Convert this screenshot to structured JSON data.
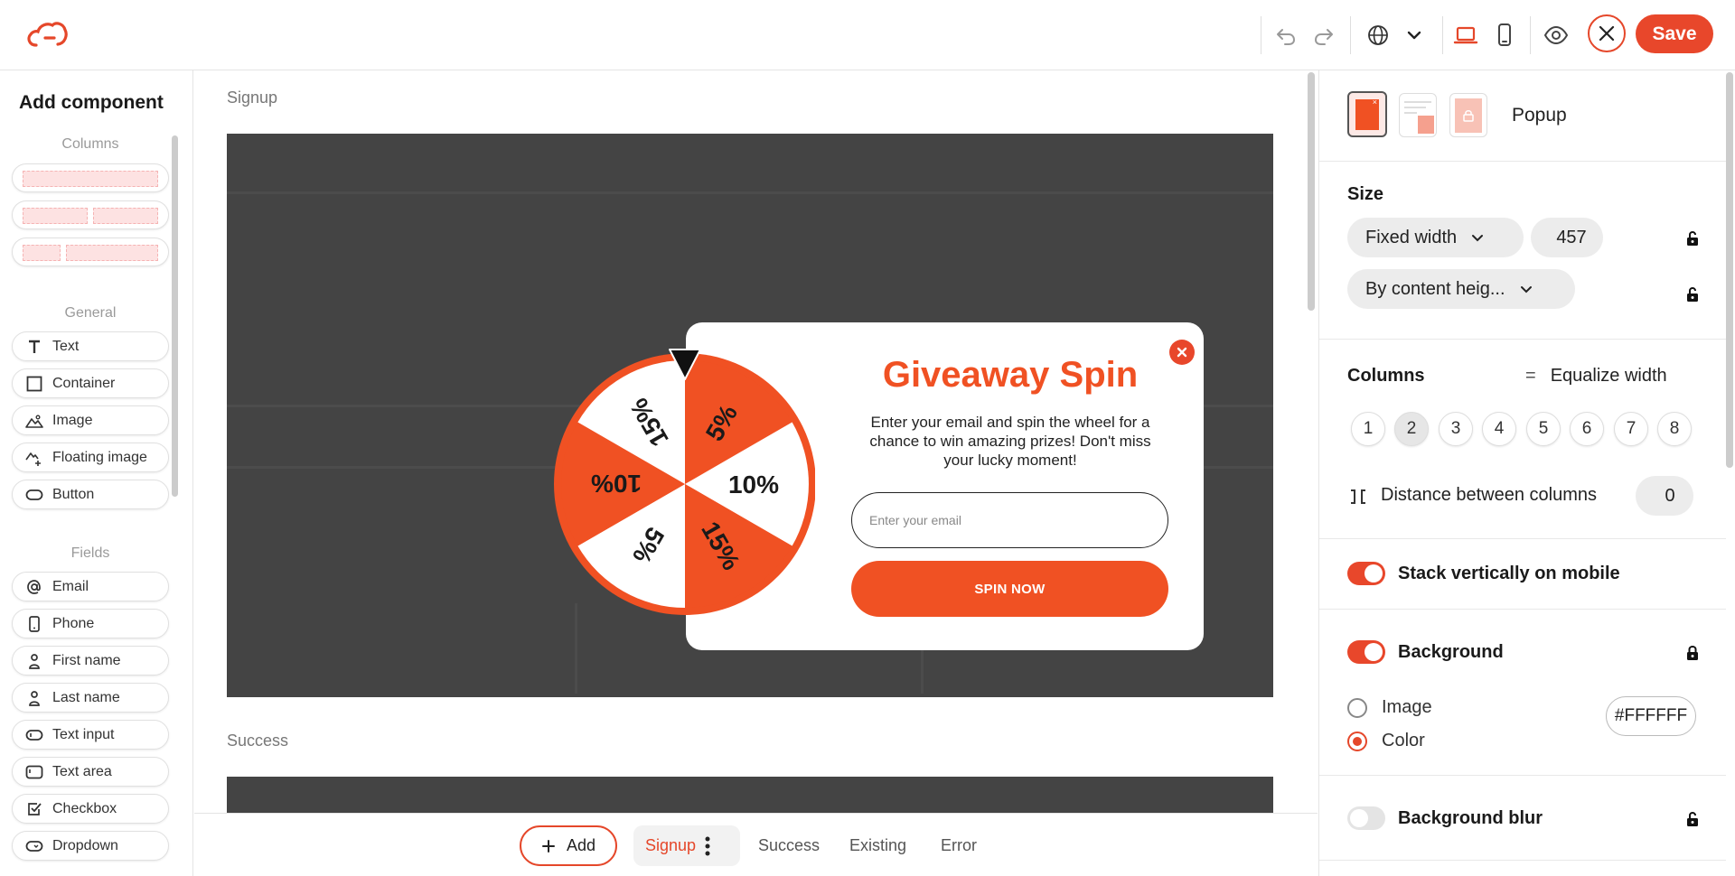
{
  "toolbar": {
    "save_label": "Save"
  },
  "left_panel": {
    "title": "Add component",
    "sections": {
      "columns": "Columns",
      "general": "General",
      "fields": "Fields"
    },
    "general_items": [
      "Text",
      "Container",
      "Image",
      "Floating image",
      "Button"
    ],
    "field_items": [
      "Email",
      "Phone",
      "First name",
      "Last name",
      "Text input",
      "Text area",
      "Checkbox",
      "Dropdown"
    ]
  },
  "canvas": {
    "steps": [
      "Signup",
      "Success"
    ],
    "popup": {
      "title": "Giveaway Spin",
      "description": "Enter your email and spin the wheel for a chance to win amazing prizes! Don't miss your lucky moment!",
      "email_placeholder": "Enter your email",
      "button_label": "SPIN NOW",
      "wheel_labels": [
        "5%",
        "10%",
        "15%",
        "5%",
        "10%",
        "15%"
      ],
      "colors": {
        "accent": "#F05123",
        "background": "#FFFFFF"
      }
    }
  },
  "bottom_bar": {
    "add_label": "Add",
    "tabs": [
      "Signup",
      "Success",
      "Existing",
      "Error"
    ],
    "active_tab": "Signup"
  },
  "right_panel": {
    "layout_label": "Popup",
    "size": {
      "heading": "Size",
      "width_mode": "Fixed width",
      "width_value": "457",
      "height_mode": "By content heig..."
    },
    "columns": {
      "heading": "Columns",
      "equalize_label": "Equalize width",
      "options": [
        "1",
        "2",
        "3",
        "4",
        "5",
        "6",
        "7",
        "8"
      ],
      "selected": "2",
      "distance_label": "Distance between columns",
      "distance_value": "0"
    },
    "stack_mobile": {
      "label": "Stack vertically on mobile",
      "enabled": true
    },
    "background": {
      "label": "Background",
      "enabled": true,
      "options": [
        "Image",
        "Color"
      ],
      "selected": "Color",
      "color_value": "#FFFFFF"
    },
    "background_blur": {
      "label": "Background blur",
      "enabled": false
    }
  },
  "colors": {
    "accent": "#E8472B"
  }
}
